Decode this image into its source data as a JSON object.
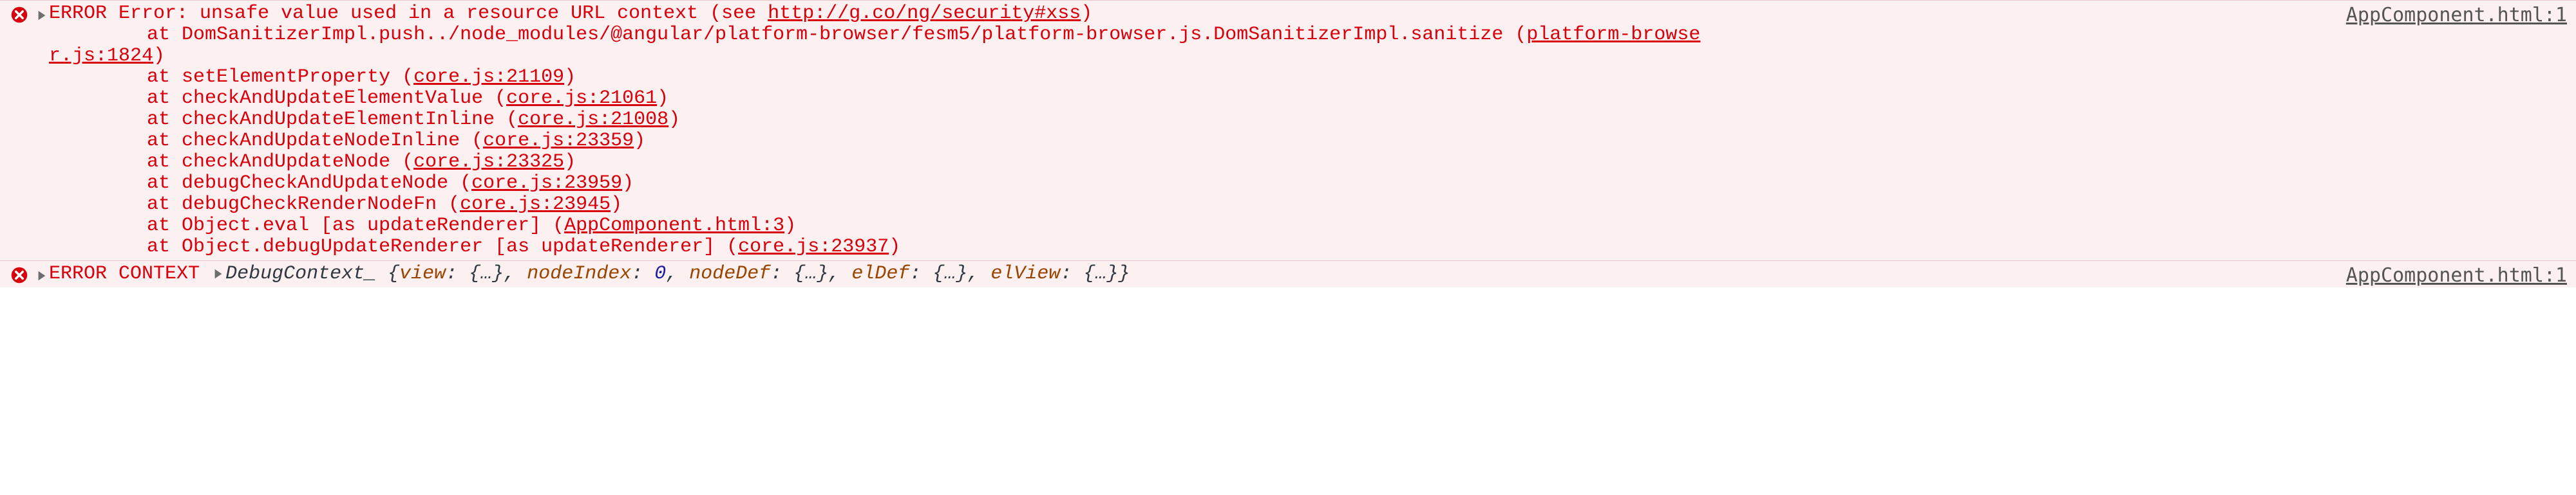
{
  "entries": [
    {
      "source_link": "AppComponent.html:1",
      "label": "ERROR",
      "message_prefix": "Error: unsafe value used in a resource URL context (see ",
      "message_link": "http://g.co/ng/security#xss",
      "message_suffix": ")",
      "sanitize_at": "    at DomSanitizerImpl.push../node_modules/@angular/platform-browser/fesm5/platform-browser.js.DomSanitizerImpl.sanitize (",
      "sanitize_link_a": "platform-browse",
      "sanitize_link_b": "r.js:1824",
      "sanitize_close": ")",
      "stack": [
        {
          "at": "    at setElementProperty (",
          "link": "core.js:21109",
          "close": ")"
        },
        {
          "at": "    at checkAndUpdateElementValue (",
          "link": "core.js:21061",
          "close": ")"
        },
        {
          "at": "    at checkAndUpdateElementInline (",
          "link": "core.js:21008",
          "close": ")"
        },
        {
          "at": "    at checkAndUpdateNodeInline (",
          "link": "core.js:23359",
          "close": ")"
        },
        {
          "at": "    at checkAndUpdateNode (",
          "link": "core.js:23325",
          "close": ")"
        },
        {
          "at": "    at debugCheckAndUpdateNode (",
          "link": "core.js:23959",
          "close": ")"
        },
        {
          "at": "    at debugCheckRenderNodeFn (",
          "link": "core.js:23945",
          "close": ")"
        },
        {
          "at": "    at Object.eval [as updateRenderer] (",
          "link": "AppComponent.html:3",
          "close": ")"
        },
        {
          "at": "    at Object.debugUpdateRenderer [as updateRenderer] (",
          "link": "core.js:23937",
          "close": ")"
        }
      ]
    },
    {
      "source_link": "AppComponent.html:1",
      "label": "ERROR CONTEXT",
      "obj_name": "DebugContext_",
      "fields": [
        {
          "key": "view",
          "val": "{…}"
        },
        {
          "key": "nodeIndex",
          "val": "0",
          "num": true
        },
        {
          "key": "nodeDef",
          "val": "{…}"
        },
        {
          "key": "elDef",
          "val": "{…}"
        },
        {
          "key": "elView",
          "val": "{…}"
        }
      ]
    }
  ]
}
